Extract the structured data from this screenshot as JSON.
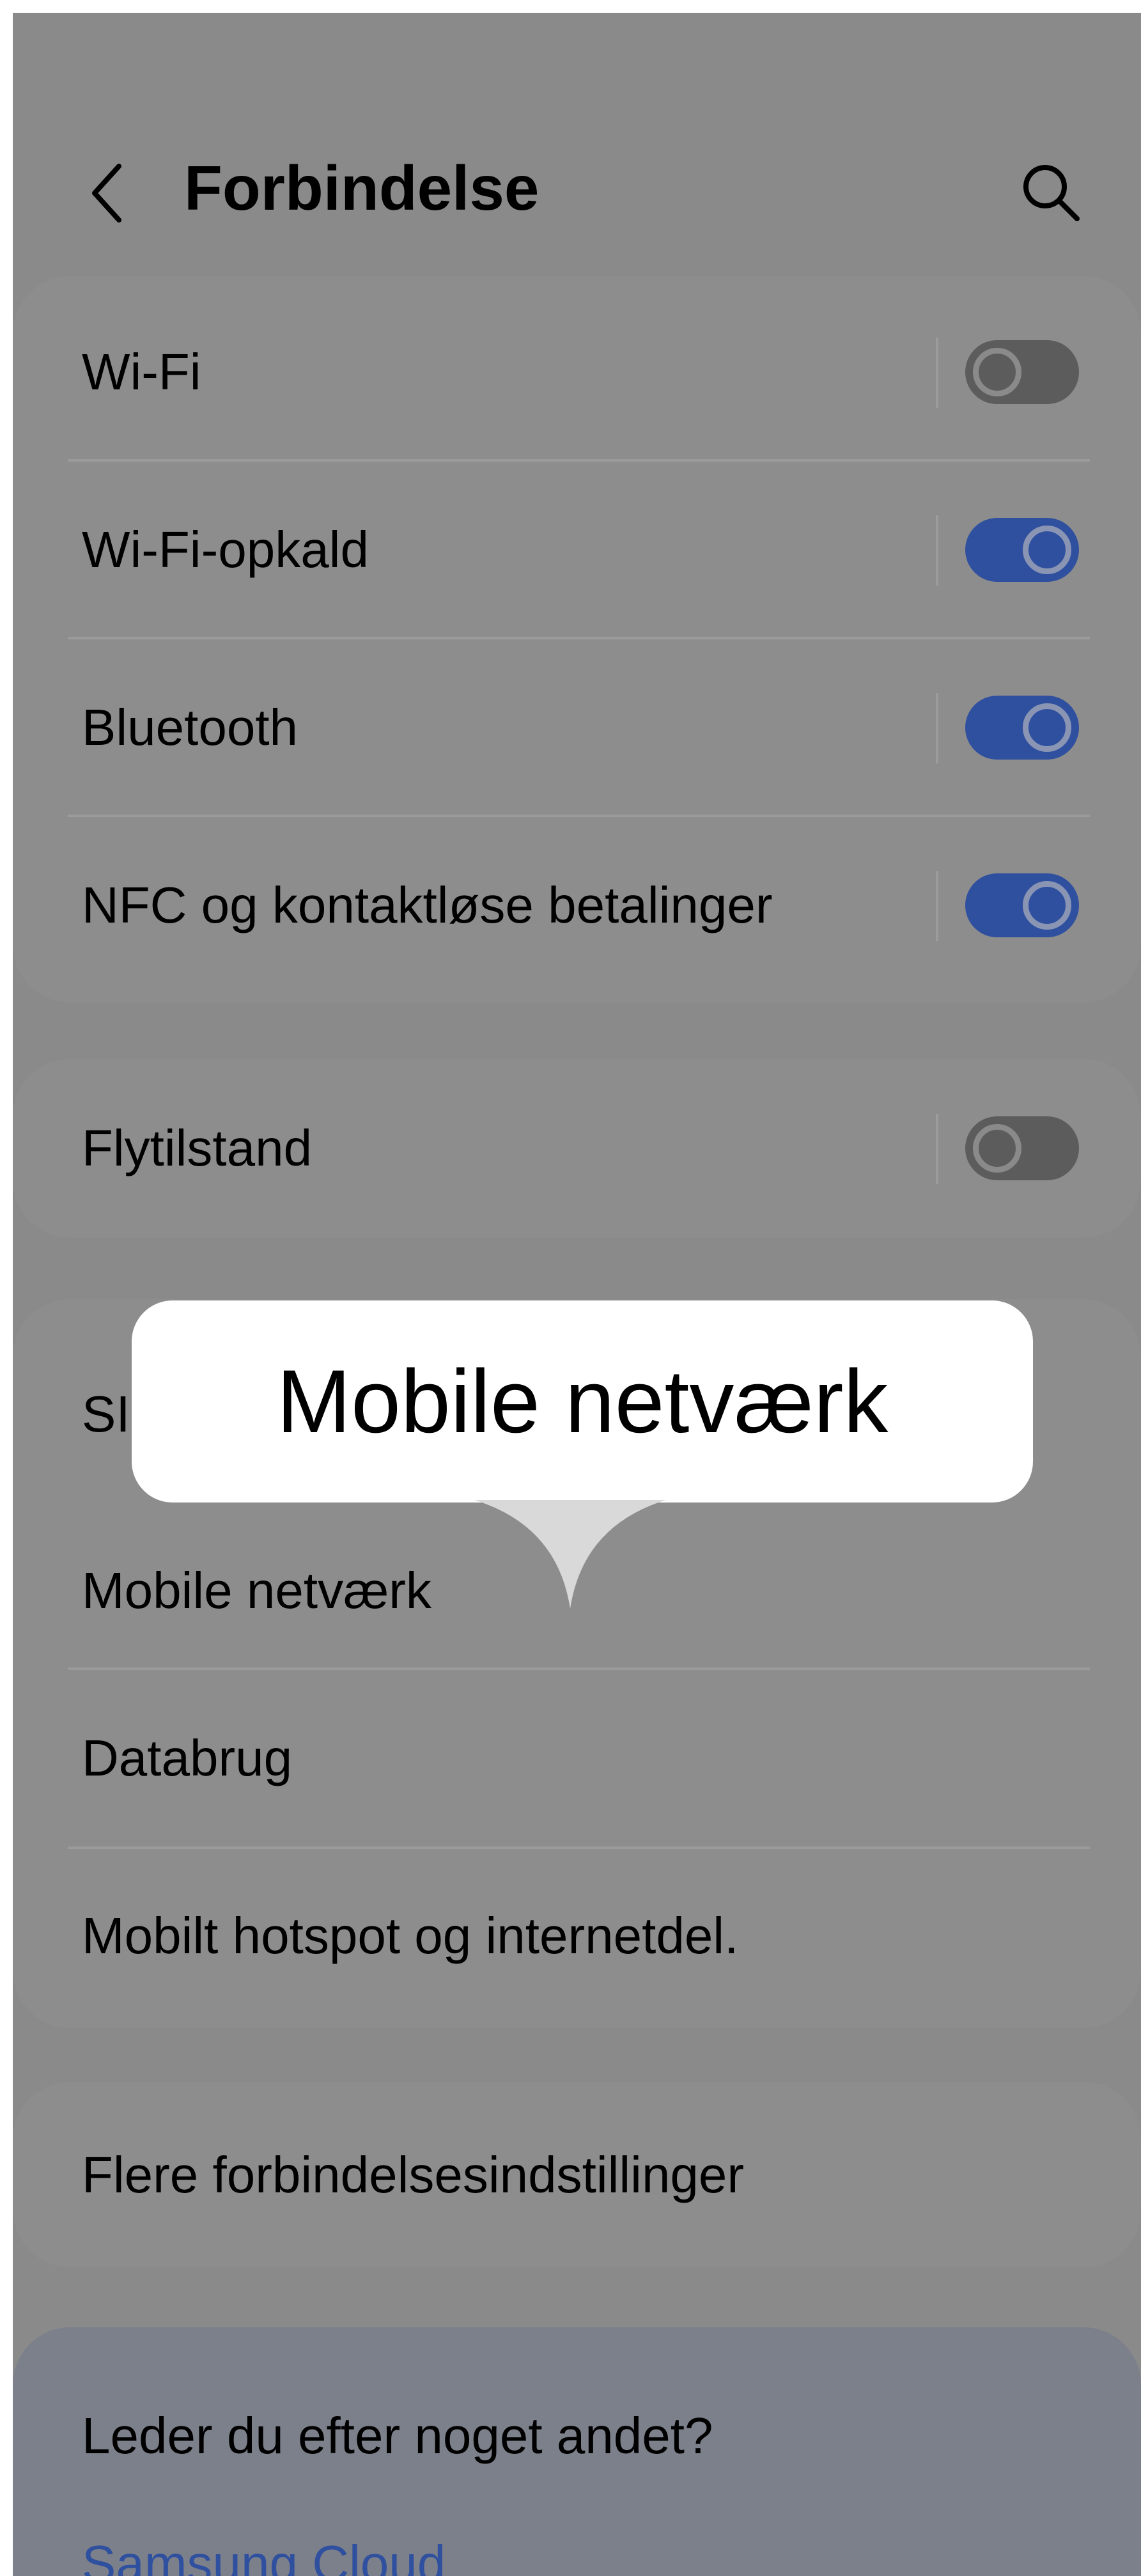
{
  "header": {
    "title": "Forbindelse"
  },
  "icons": {
    "back": "chevron-left-icon",
    "search": "search-icon"
  },
  "colors": {
    "toggle_on": "#2f4f9f",
    "toggle_off": "#5c5c5c",
    "link": "#2f4f9f",
    "overlay": "#8a8a8a"
  },
  "group1": [
    {
      "label": "Wi-Fi",
      "toggle": false
    },
    {
      "label": "Wi-Fi-opkald",
      "toggle": true
    },
    {
      "label": "Bluetooth",
      "toggle": true
    },
    {
      "label": "NFC og kontaktløse betalinger",
      "toggle": true
    }
  ],
  "group2": [
    {
      "label": "Flytilstand",
      "toggle": false
    }
  ],
  "group3": [
    {
      "label": "SI"
    },
    {
      "label": "Mobile netværk"
    },
    {
      "label": "Databrug"
    },
    {
      "label": "Mobilt hotspot og internetdel."
    }
  ],
  "group4": [
    {
      "label": "Flere forbindelsesindstillinger"
    }
  ],
  "suggestions": {
    "title": "Leder du efter noget andet?",
    "link": "Samsung Cloud"
  },
  "tooltip": {
    "text": "Mobile netværk"
  }
}
